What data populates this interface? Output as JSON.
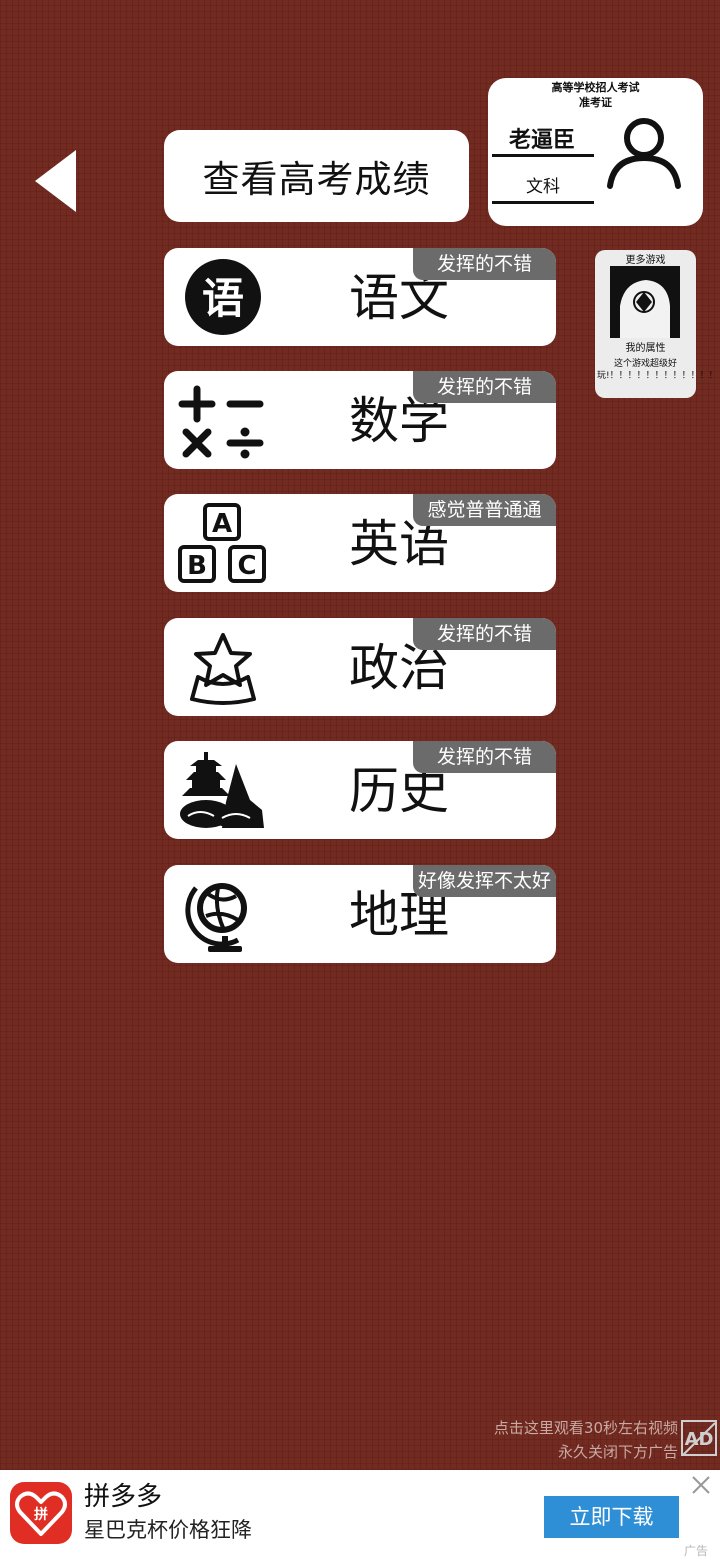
{
  "header": {
    "scores_button_label": "查看高考成绩"
  },
  "ticket": {
    "title_line1": "高等学校招人考试",
    "title_line2": "准考证",
    "student_name": "老逼臣",
    "subject_track": "文科"
  },
  "subjects": [
    {
      "name": "语文",
      "badge": "发挥的不错",
      "icon": "yu-character-icon"
    },
    {
      "name": "数学",
      "badge": "发挥的不错",
      "icon": "math-operators-icon"
    },
    {
      "name": "英语",
      "badge": "感觉普普通通",
      "icon": "abc-blocks-icon"
    },
    {
      "name": "政治",
      "badge": "发挥的不错",
      "icon": "star-ribbon-icon"
    },
    {
      "name": "历史",
      "badge": "发挥的不错",
      "icon": "pagoda-icon"
    },
    {
      "name": "地理",
      "badge": "好像发挥不太好",
      "icon": "globe-icon"
    }
  ],
  "more_games": {
    "title": "更多游戏",
    "attribute_label": "我的属性",
    "description": "这个游戏超级好玩!！！！！！！！！！！！！"
  },
  "video_hint": {
    "line1": "点击这里观看30秒左右视频",
    "line2": "永久关闭下方广告"
  },
  "ad": {
    "app_name": "拼多多",
    "slogan": "星巴克杯价格狂降",
    "download_label": "立即下载",
    "tag": "广告",
    "brand_color": "#e02e24",
    "button_color": "#2f8fd6"
  }
}
